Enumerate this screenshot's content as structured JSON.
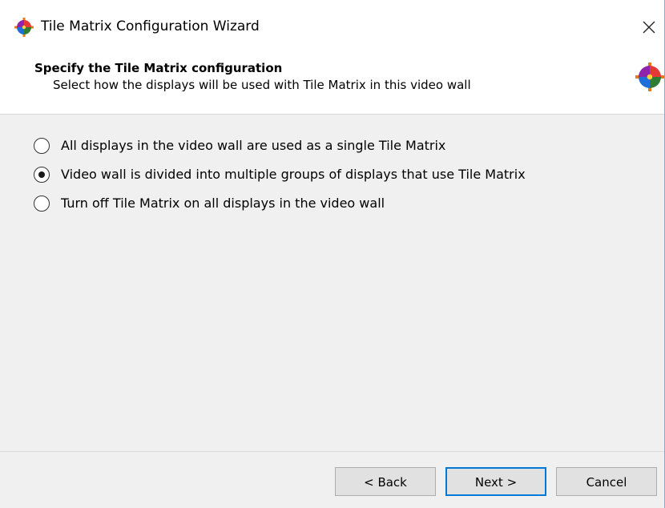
{
  "window": {
    "title": "Tile Matrix Configuration Wizard",
    "app_icon": "tile-matrix-color-wheel-icon",
    "close_icon": "close-icon"
  },
  "header": {
    "title": "Specify the Tile Matrix configuration",
    "subtitle": "Select how the displays will be used with Tile Matrix in this video wall",
    "icon": "tile-matrix-color-wheel-icon"
  },
  "options": [
    {
      "label": "All displays in the video wall are used as a single Tile Matrix",
      "selected": false
    },
    {
      "label": "Video wall is divided into multiple groups of displays that use Tile Matrix",
      "selected": true
    },
    {
      "label": "Turn off Tile Matrix on all displays in the video wall",
      "selected": false
    }
  ],
  "footer": {
    "back_label": "< Back",
    "next_label": "Next >",
    "cancel_label": "Cancel",
    "default_button": "next"
  },
  "colors": {
    "content_bg": "#f0f0f0",
    "accent": "#0078d7",
    "button_bg": "#e1e1e1"
  }
}
